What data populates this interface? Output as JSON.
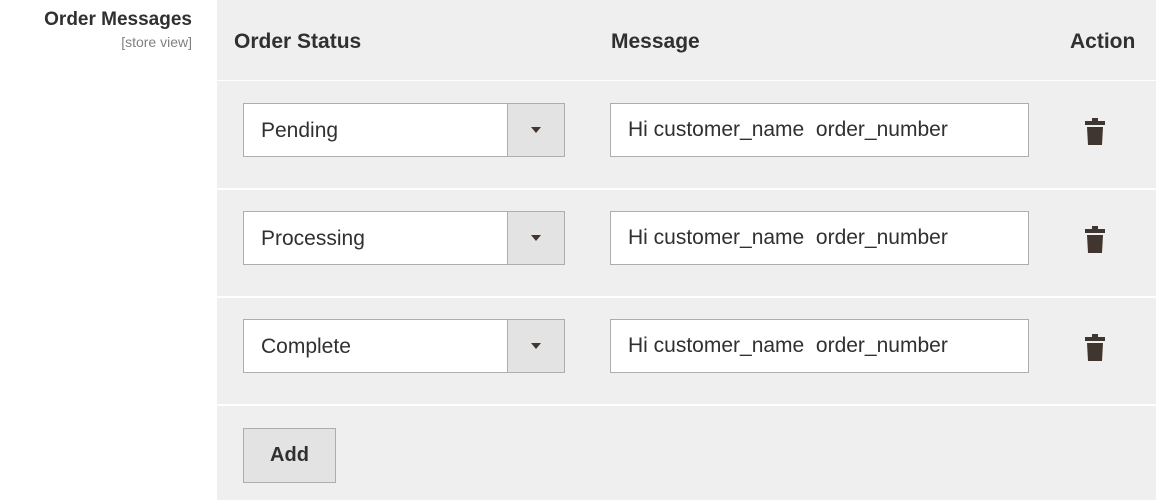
{
  "field": {
    "label": "Order Messages",
    "scope": "[store view]"
  },
  "grid": {
    "headers": {
      "status": "Order Status",
      "message": "Message",
      "action": "Action"
    },
    "rows": [
      {
        "status": "Pending",
        "message": "Hi customer_name  order_number",
        "action_icon": "trash-icon"
      },
      {
        "status": "Processing",
        "message": "Hi customer_name  order_number",
        "action_icon": "trash-icon"
      },
      {
        "status": "Complete",
        "message": "Hi customer_name  order_number",
        "action_icon": "trash-icon"
      }
    ],
    "add_label": "Add"
  },
  "colors": {
    "grid_background": "#efefef",
    "button_background": "#e3e3e3",
    "border": "#adadad",
    "text": "#303030",
    "icon": "#41362f"
  }
}
